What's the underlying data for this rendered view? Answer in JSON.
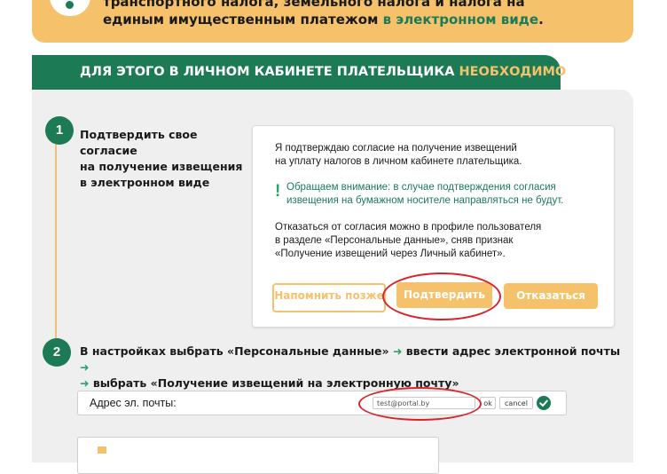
{
  "banner": {
    "line1": "транспортного налога, земельного налога и налога на недвижимость",
    "line2_plain": "единым имущественным платежом ",
    "line2_green": "в электронном виде",
    "line2_end": "."
  },
  "header": {
    "text": "ДЛЯ ЭТОГО В ЛИЧНОМ КАБИНЕТЕ ПЛАТЕЛЬЩИКА ",
    "highlight": "НЕОБХОДИМО",
    "end": ":"
  },
  "steps": [
    {
      "number": "1",
      "title_lines": [
        "Подтвердить свое согласие",
        "на получение извещения",
        "в электронном виде"
      ]
    },
    {
      "number": "2",
      "part1": "В настройках выбрать «Персональные данные» ",
      "part2": " ввести адрес электронной почты ",
      "part3": " выбрать «Получение извещений на электронную почту»"
    }
  ],
  "arrow_glyph": "➜",
  "consent_card": {
    "para1": [
      "Я  подтверждаю согласие на получение извещений",
      "на уплату налогов в личном кабинете плательщика."
    ],
    "warning_mark": "!",
    "warning": [
      "Обращаем внимание: в случае подтверждения согласия",
      "извещения на бумажном носителе направляться не будут."
    ],
    "para2": [
      "Отказаться от согласия можно в профиле пользователя",
      "в разделе «Персональные данные», сняв признак",
      "«Получение извещений через Личный кабинет»."
    ],
    "buttons": {
      "remind": "Напомнить позже",
      "confirm": "Подтвердить",
      "refuse": "Отказаться"
    }
  },
  "email_form": {
    "label": "Адрес эл. почты:",
    "value": "test@portal.by",
    "ok": "ok",
    "cancel": "cancel"
  },
  "colors": {
    "brand_green": "#1c7a55",
    "accent_yellow": "#f5c26b",
    "highlight_red": "#d8232a",
    "panel_gray": "#f0efef"
  },
  "icons": {
    "banner": "speech-bubble-icon",
    "check": "check-circle-icon",
    "arrow": "arrow-right-icon"
  }
}
